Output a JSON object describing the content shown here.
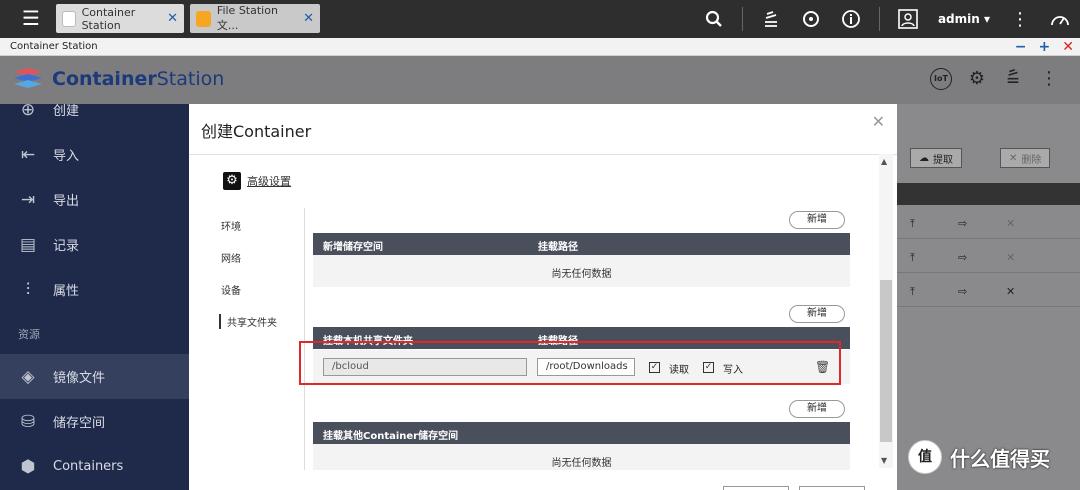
{
  "os_bar": {
    "tabs": [
      {
        "label": "Container Station",
        "active": true
      },
      {
        "label": "File Station 文...",
        "active": false
      }
    ],
    "user": "admin"
  },
  "window": {
    "title": "Container Station"
  },
  "app": {
    "brand_bold": "Container",
    "brand_light": "Station",
    "iot_label": "IoT"
  },
  "sidebar": {
    "items": [
      {
        "label": "创建",
        "icon": "plus-circle-icon"
      },
      {
        "label": "导入",
        "icon": "import-icon"
      },
      {
        "label": "导出",
        "icon": "export-icon"
      },
      {
        "label": "记录",
        "icon": "log-icon"
      },
      {
        "label": "属性",
        "icon": "sliders-icon"
      }
    ],
    "section_label": "资源",
    "resource_items": [
      {
        "label": "镜像文件",
        "icon": "layers-icon",
        "active": true
      },
      {
        "label": "储存空间",
        "icon": "database-icon"
      },
      {
        "label": "Containers",
        "icon": "cube-icon"
      }
    ]
  },
  "background": {
    "pull_label": "提取",
    "delete_label": "删除"
  },
  "modal": {
    "title": "创建Container",
    "advanced_label": "高级设置",
    "nav": [
      "环境",
      "网络",
      "设备",
      "共享文件夹"
    ],
    "active_nav": "共享文件夹",
    "add_label": "新增",
    "empty_text": "尚无任何数据",
    "table1": {
      "col1": "新增储存空间",
      "col2": "挂载路径"
    },
    "table2": {
      "col1": "挂载本机共享文件夹",
      "col2": "挂载路径"
    },
    "table3": {
      "col1": "挂载其他Container储存空间"
    },
    "mount": {
      "host_path": "/bcloud",
      "container_path": "/root/Downloads",
      "read_label": "读取",
      "write_label": "写入",
      "read_checked": true,
      "write_checked": true
    }
  },
  "watermark": {
    "badge": "值",
    "text": "什么值得买"
  }
}
